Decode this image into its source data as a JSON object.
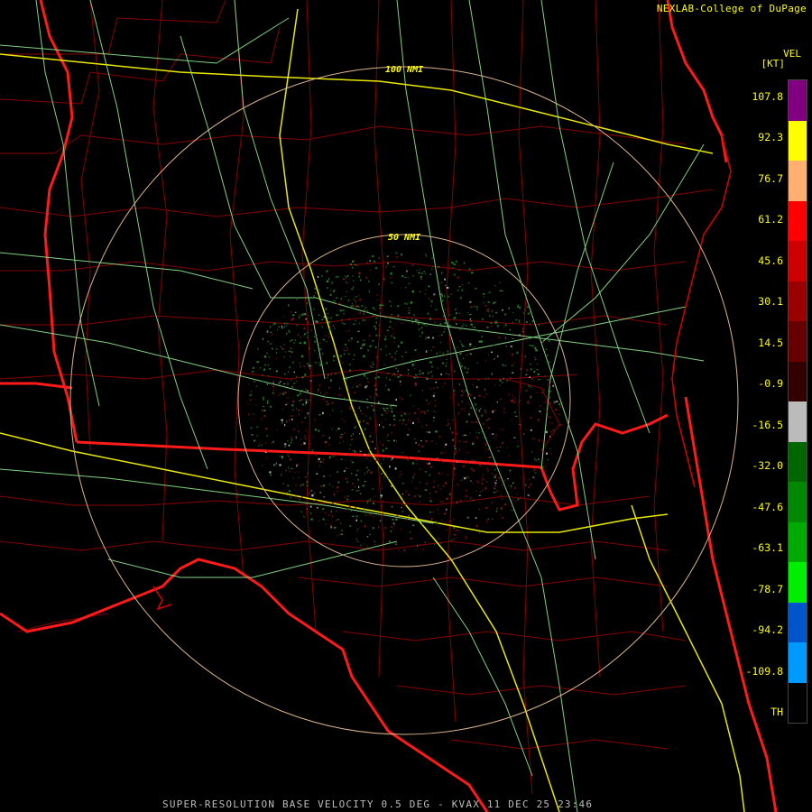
{
  "header": {
    "credit": "NEXLAB-College of DuPage",
    "product_code": "VEL",
    "units": "[KT]"
  },
  "range_rings": [
    "100 NMI",
    "50 NMI"
  ],
  "color_scale": {
    "ticks": [
      "107.8",
      "92.3",
      "76.7",
      "61.2",
      "45.6",
      "30.1",
      "14.5",
      "-0.9",
      "-16.5",
      "-32.0",
      "-47.6",
      "-63.1",
      "-78.7",
      "-94.2",
      "-109.8",
      "TH"
    ],
    "colors": [
      "#800080",
      "#ffff00",
      "#ffb070",
      "#ff0000",
      "#cc0000",
      "#990000",
      "#660000",
      "#330000",
      "#bbbbbb",
      "#006600",
      "#008800",
      "#00aa00",
      "#00ee00",
      "#0055cc",
      "#0099ff",
      "#000000"
    ]
  },
  "footer": {
    "caption": "SUPER-RESOLUTION BASE VELOCITY 0.5 DEG - KVAX 11 DEC 25 23:46"
  }
}
